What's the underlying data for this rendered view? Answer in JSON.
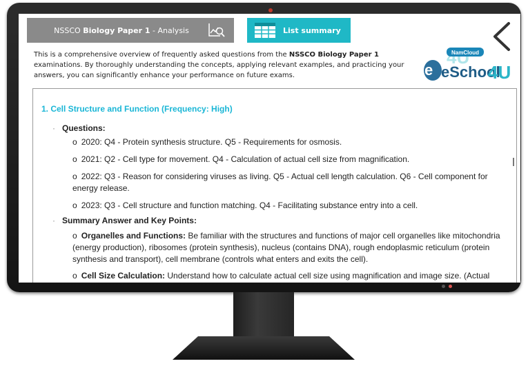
{
  "header": {
    "analysis_prefix": "NSSCO ",
    "analysis_bold": "Biology Paper 1",
    "analysis_suffix": " - Analysis",
    "summary_tab": "List summary"
  },
  "intro": {
    "pre": "This is a comprehensive overview of frequently asked questions from the ",
    "bold": "NSSCO Biology Paper 1",
    "post": " examinations. By thoroughly understanding the concepts, applying relevant examples, and practicing your answers, you can significantly enhance your performance on future exams."
  },
  "logo": {
    "top": "NamCloud",
    "main": "eSchool",
    "suffix": "4U"
  },
  "icons": {
    "chart": "chart-search-icon",
    "table": "table-icon",
    "back": "chevron-left-icon"
  },
  "colors": {
    "accent": "#1fb8c6",
    "tab_gray": "#8a8a8a",
    "heading": "#19b6d6"
  },
  "content": {
    "heading": "1. Cell Structure and Function (Frequency: High)",
    "questions_label": "Questions:",
    "questions": [
      "2020: Q4 - Protein synthesis structure. Q5 - Requirements for osmosis.",
      "2021: Q2 - Cell type for movement. Q4 - Calculation of actual cell size from magnification.",
      "2022: Q3 - Reason for considering viruses as living. Q5 - Actual cell length calculation. Q6 - Cell component for energy release.",
      "2023: Q3 - Cell structure and function matching. Q4 - Facilitating substance entry into a cell."
    ],
    "summary_label": "Summary Answer and Key Points:",
    "points": [
      {
        "title": "Organelles and Functions:",
        "text": " Be familiar with the structures and functions of major cell organelles like mitochondria (energy production), ribosomes (protein synthesis), nucleus (contains DNA), rough endoplasmic reticulum (protein synthesis and transport), cell membrane (controls what enters and exits the cell)."
      },
      {
        "title": "Cell Size Calculation:",
        "text": " Understand how to calculate actual cell size using magnification and image size. (Actual size = Image size / Magnification)."
      }
    ]
  }
}
